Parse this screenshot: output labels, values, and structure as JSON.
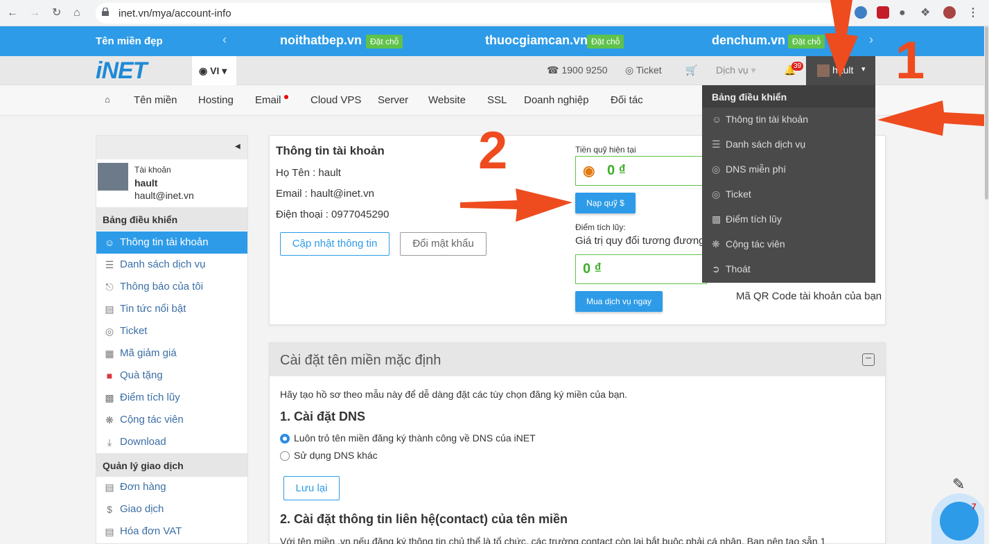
{
  "browser": {
    "url": "inet.vn/mya/account-info"
  },
  "promo": {
    "label": "Tên miền đẹp",
    "domains": [
      {
        "name": "noithatbep.vn",
        "badge": "Đặt chỗ"
      },
      {
        "name": "thuocgiamcan.vn",
        "badge": "Đặt chỗ"
      },
      {
        "name": "denchum.vn",
        "badge": "Đặt chỗ"
      }
    ]
  },
  "header": {
    "logo": "iNET",
    "lang": "VI",
    "phone": "1900 9250",
    "ticket": "Ticket",
    "service": "Dịch vụ",
    "notif_count": "39",
    "username": "hault"
  },
  "nav": [
    "Tên miền",
    "Hosting",
    "Email",
    "Cloud VPS",
    "Server",
    "Website",
    "SSL",
    "Doanh nghiệp",
    "Đối tác"
  ],
  "sidebar": {
    "account_label": "Tài khoản",
    "name": "hault",
    "email": "hault@inet.vn",
    "section1": "Bảng điều khiển",
    "items1": [
      "Thông tin tài khoản",
      "Danh sách dịch vụ",
      "Thông báo của tôi",
      "Tin tức nổi bật",
      "Ticket",
      "Mã giảm giá",
      "Quà tặng",
      "Điểm tích lũy",
      "Cộng tác viên",
      "Download"
    ],
    "section2": "Quản lý giao dịch",
    "items2": [
      "Đơn hàng",
      "Giao dịch",
      "Hóa đơn VAT"
    ]
  },
  "account": {
    "title": "Thông tin tài khoản",
    "name_line": "Họ Tên : hault",
    "email_line": "Email : hault@inet.vn",
    "phone_line": "Điện thoại : 0977045290",
    "update_btn": "Cập nhật thông tin",
    "password_btn": "Đổi mật khẩu",
    "fund_label": "Tiền quỹ hiện tại",
    "fund_value": "0 ₫",
    "topup_btn": "Nạp quỹ $",
    "points_label": "Điểm tích lũy:",
    "points_desc": "Giá trị quy đổi tương đương",
    "points_value": "0 ₫",
    "buy_btn": "Mua dịch vụ ngay",
    "qr_caption": "Mã QR Code tài khoản của bạn"
  },
  "domain_settings": {
    "title": "Cài đặt tên miền mặc định",
    "intro": "Hãy tạo hồ sơ theo mẫu này để dễ dàng đặt các tùy chọn đăng ký miền của bạn.",
    "dns_title": "1. Cài đặt DNS",
    "dns_option1": "Luôn trỏ tên miền đăng ký thành công về DNS của iNET",
    "dns_option2": "Sử dụng DNS khác",
    "save_btn": "Lưu lại",
    "contact_title": "2. Cài đặt thông tin liên hệ(contact) của tên miền",
    "contact_desc": "Với tên miền .vn nếu đăng ký thông tin chủ thể là tổ chức, các trường contact còn lại bắt buộc phải cá nhân. Bạn nên tạo sẵn 1"
  },
  "dropdown": {
    "header": "Bảng điều khiển",
    "items": [
      "Thông tin tài khoản",
      "Danh sách dịch vụ",
      "DNS miễn phí",
      "Ticket",
      "Điểm tích lũy",
      "Cộng tác viên",
      "Thoát"
    ]
  },
  "annotations": {
    "step1": "1",
    "step2": "2"
  },
  "chat": {
    "badge": "7"
  },
  "colors": {
    "brand": "#2d9be8",
    "green": "#5fc24a",
    "arrow": "#ee4b1f"
  }
}
